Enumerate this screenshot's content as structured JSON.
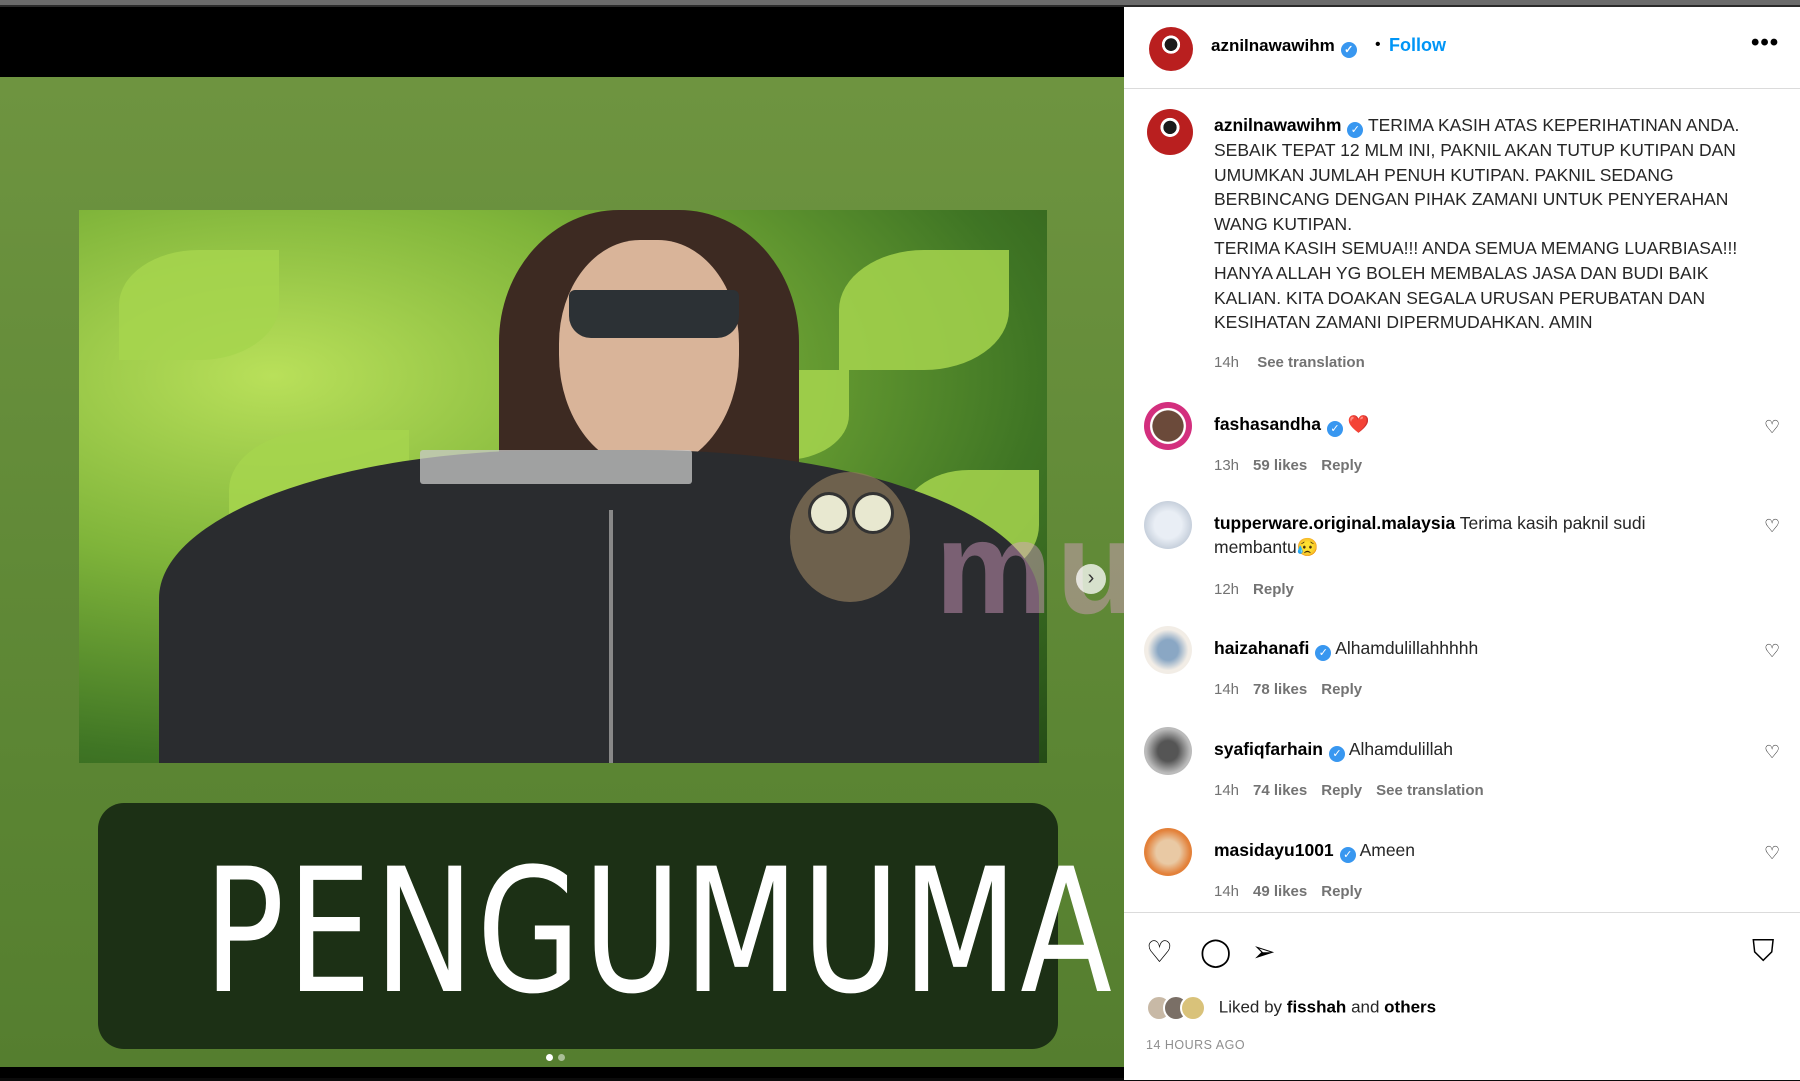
{
  "post": {
    "banner_text": "PENGUMUMAN",
    "watermark": "murai",
    "next_icon": "›",
    "slides": 2
  },
  "header": {
    "username": "aznilnawawihm",
    "separator": "•",
    "follow_label": "Follow",
    "more_label": "•••"
  },
  "caption": {
    "username": "aznilnawawihm",
    "line1": "TERIMA KASIH ATAS KEPERIHATINAN ANDA. SEBAIK TEPAT 12 MLM INI, PAKNIL AKAN TUTUP KUTIPAN DAN UMUMKAN JUMLAH PENUH KUTIPAN. PAKNIL SEDANG BERBINCANG DENGAN PIHAK ZAMANI UNTUK PENYERAHAN WANG KUTIPAN.",
    "line2": "TERIMA KASIH SEMUA!!! ANDA SEMUA MEMANG LUARBIASA!!! HANYA ALLAH YG BOLEH MEMBALAS JASA DAN BUDI BAIK KALIAN. KITA DOAKAN SEGALA URUSAN PERUBATAN DAN KESIHATAN ZAMANI DIPERMUDAHKAN. AMIN",
    "time": "14h",
    "see_translation": "See translation"
  },
  "comments": [
    {
      "username": "fashasandha",
      "verified": true,
      "text": "❤️",
      "time": "13h",
      "likes": "59 likes",
      "reply": "Reply"
    },
    {
      "username": "tupperware.original.malaysia",
      "verified": false,
      "text": "Terima kasih paknil sudi membantu😥",
      "time": "12h",
      "likes": "",
      "reply": "Reply"
    },
    {
      "username": "haizahanafi",
      "verified": true,
      "text": "Alhamdulillahhhhh",
      "time": "14h",
      "likes": "78 likes",
      "reply": "Reply"
    },
    {
      "username": "syafiqfarhain",
      "verified": true,
      "text": "Alhamdulillah",
      "time": "14h",
      "likes": "74 likes",
      "reply": "Reply",
      "see_translation": "See translation"
    },
    {
      "username": "masidayu1001",
      "verified": true,
      "text": "Ameen",
      "time": "14h",
      "likes": "49 likes",
      "reply": "Reply"
    }
  ],
  "actions": {
    "like_icon": "♡",
    "comment_icon": "◯",
    "share_icon": "➢",
    "save_icon": "⛉",
    "liked_by_prefix": "Liked by",
    "liked_by_user": "fisshah",
    "liked_by_and": "and",
    "liked_by_others": "others",
    "time_ago": "14 HOURS AGO"
  },
  "colors": {
    "follow": "#0095f6",
    "verified": "#3897f0",
    "banner_bg": "#1c3015",
    "media_green": "#5b8533"
  }
}
